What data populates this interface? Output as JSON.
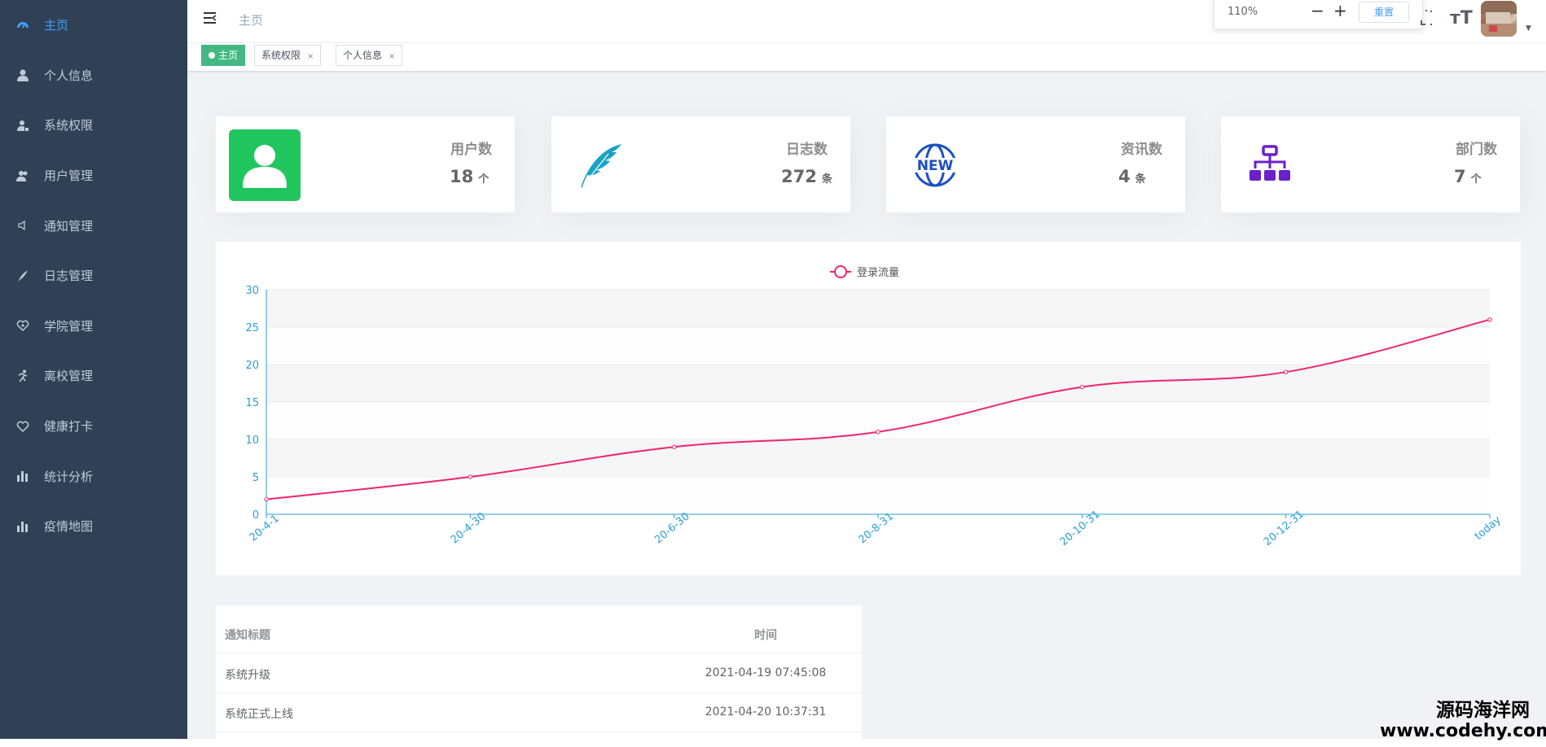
{
  "sidebar": {
    "items": [
      {
        "label": "主页",
        "icon": "dashboard-icon",
        "active": true
      },
      {
        "label": "个人信息",
        "icon": "user-icon"
      },
      {
        "label": "系统权限",
        "icon": "user-lock-icon"
      },
      {
        "label": "用户管理",
        "icon": "users-icon"
      },
      {
        "label": "通知管理",
        "icon": "speaker-icon"
      },
      {
        "label": "日志管理",
        "icon": "feather-icon"
      },
      {
        "label": "学院管理",
        "icon": "heart-hand-icon"
      },
      {
        "label": "离校管理",
        "icon": "run-icon"
      },
      {
        "label": "健康打卡",
        "icon": "heart-icon"
      },
      {
        "label": "统计分析",
        "icon": "bar-chart-icon"
      },
      {
        "label": "疫情地图",
        "icon": "bar-chart-icon"
      }
    ]
  },
  "navbar": {
    "breadcrumb": "主页",
    "zoom": {
      "value": "110%",
      "minus": "−",
      "plus": "+",
      "reset": "重置"
    },
    "size_icon": "тT"
  },
  "tags": [
    {
      "label": "主页",
      "active": true
    },
    {
      "label": "系统权限",
      "close": "×"
    },
    {
      "label": "个人信息",
      "close": "×"
    }
  ],
  "cards": [
    {
      "title": "用户数",
      "value": "18",
      "unit": "个",
      "color": "#21c55d"
    },
    {
      "title": "日志数",
      "value": "272",
      "unit": "条",
      "color": "#1aa3c5"
    },
    {
      "title": "资讯数",
      "value": "4",
      "unit": "条",
      "color": "#1b4fc4"
    },
    {
      "title": "部门数",
      "value": "7",
      "unit": "个",
      "color": "#6b21c9"
    }
  ],
  "chart_data": {
    "type": "line",
    "series": [
      {
        "name": "登录流量",
        "color": "#f0246e",
        "values": [
          2,
          5,
          9,
          11,
          17,
          19,
          26
        ]
      }
    ],
    "categories": [
      "20-4-1",
      "20-4-30",
      "20-6-30",
      "20-8-31",
      "20-10-31",
      "20-12-31",
      "today"
    ],
    "ylim": [
      0,
      30
    ],
    "yticks": [
      0,
      5,
      10,
      15,
      20,
      25,
      30
    ],
    "legend": "top-center",
    "axis_color": "#2a9fd6",
    "smooth": true
  },
  "table": {
    "headers": [
      "通知标题",
      "时间"
    ],
    "rows": [
      [
        "系统升级",
        "2021-04-19 07:45:08"
      ],
      [
        "系统正式上线",
        "2021-04-20 10:37:31"
      ]
    ]
  },
  "watermark": {
    "line1": "源码海洋网",
    "line2": "www.codehy.com"
  }
}
